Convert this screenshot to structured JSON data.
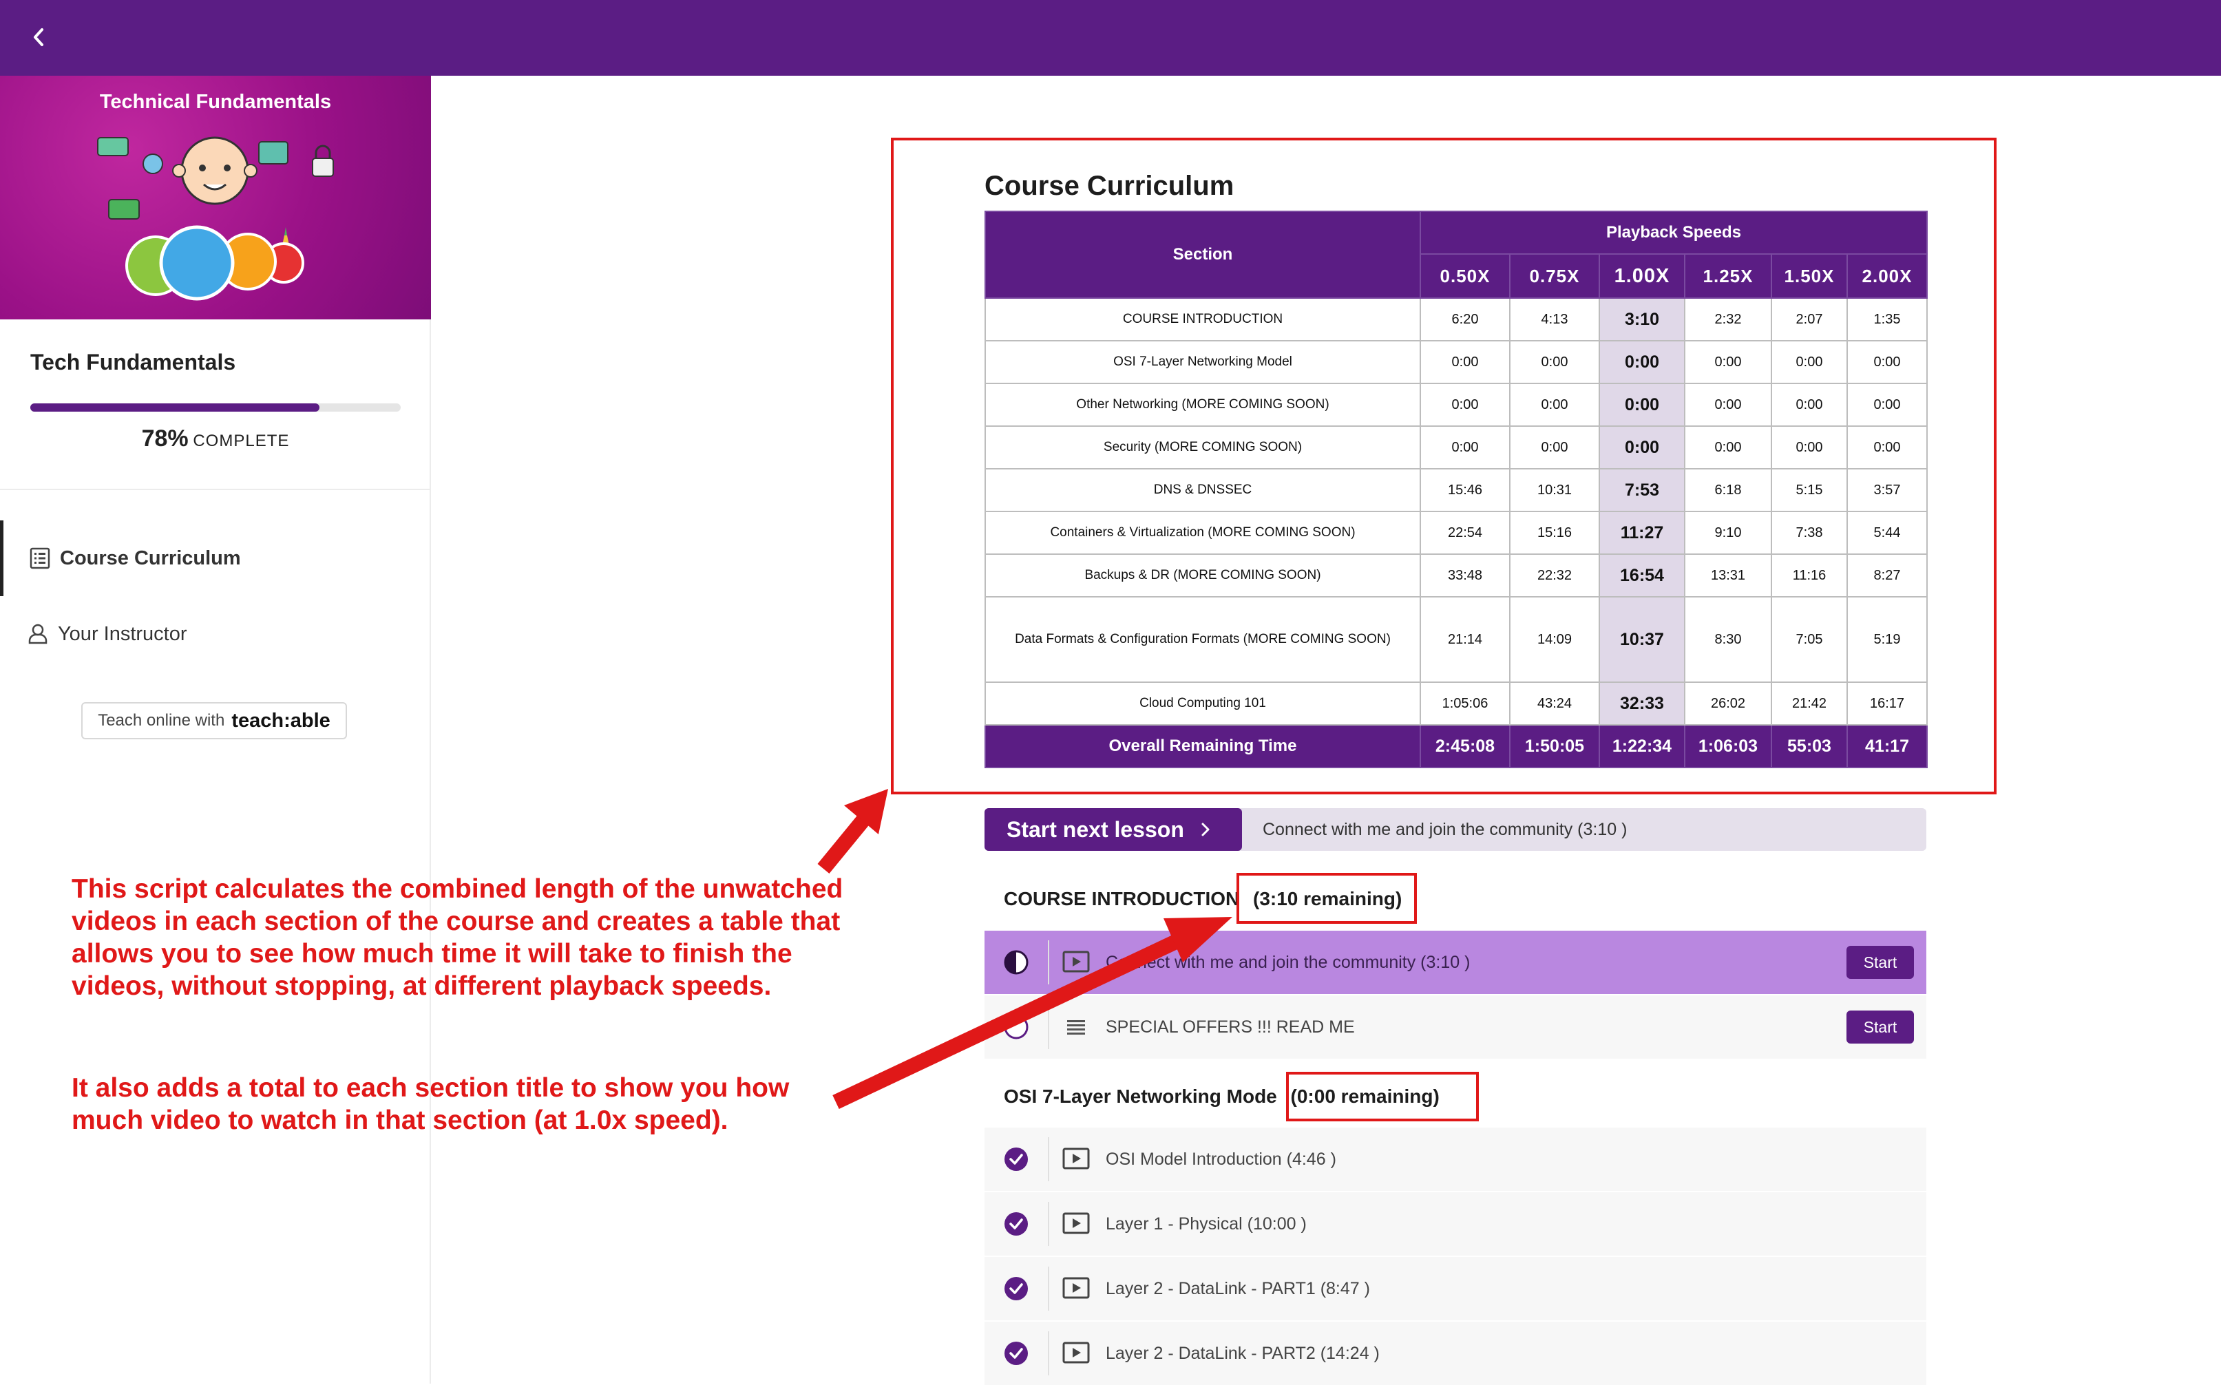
{
  "sidebar": {
    "banner_title": "Technical Fundamentals",
    "course_title": "Tech Fundamentals",
    "progress_percent": 78,
    "progress_pct_label": "78%",
    "progress_complete_label": "COMPLETE",
    "nav": [
      {
        "label": "Course Curriculum",
        "icon": "list-icon",
        "active": true
      },
      {
        "label": "Your Instructor",
        "icon": "user-icon",
        "active": false
      }
    ],
    "teach_prefix": "Teach online with",
    "teach_brand": "teach:able"
  },
  "curriculum_table": {
    "title": "Course Curriculum",
    "section_header": "Section",
    "playback_header": "Playback Speeds",
    "speeds": [
      "0.50X",
      "0.75X",
      "1.00X",
      "1.25X",
      "1.50X",
      "2.00X"
    ],
    "rows": [
      {
        "section": "COURSE INTRODUCTION",
        "times": [
          "6:20",
          "4:13",
          "3:10",
          "2:32",
          "2:07",
          "1:35"
        ]
      },
      {
        "section": "OSI 7-Layer Networking Model",
        "times": [
          "0:00",
          "0:00",
          "0:00",
          "0:00",
          "0:00",
          "0:00"
        ]
      },
      {
        "section": "Other Networking (MORE COMING SOON)",
        "times": [
          "0:00",
          "0:00",
          "0:00",
          "0:00",
          "0:00",
          "0:00"
        ]
      },
      {
        "section": "Security (MORE COMING SOON)",
        "times": [
          "0:00",
          "0:00",
          "0:00",
          "0:00",
          "0:00",
          "0:00"
        ]
      },
      {
        "section": "DNS & DNSSEC",
        "times": [
          "15:46",
          "10:31",
          "7:53",
          "6:18",
          "5:15",
          "3:57"
        ]
      },
      {
        "section": "Containers & Virtualization (MORE COMING SOON)",
        "times": [
          "22:54",
          "15:16",
          "11:27",
          "9:10",
          "7:38",
          "5:44"
        ]
      },
      {
        "section": "Backups & DR (MORE COMING SOON)",
        "times": [
          "33:48",
          "22:32",
          "16:54",
          "13:31",
          "11:16",
          "8:27"
        ]
      },
      {
        "section": "Data Formats & Configuration Formats (MORE COMING SOON)",
        "times": [
          "21:14",
          "14:09",
          "10:37",
          "8:30",
          "7:05",
          "5:19"
        ]
      },
      {
        "section": "Cloud Computing 101",
        "times": [
          "1:05:06",
          "43:24",
          "32:33",
          "26:02",
          "21:42",
          "16:17"
        ]
      }
    ],
    "total": {
      "section": "Overall Remaining Time",
      "times": [
        "2:45:08",
        "1:50:05",
        "1:22:34",
        "1:06:03",
        "55:03",
        "41:17"
      ]
    }
  },
  "start_next": {
    "button_label": "Start next lesson",
    "lesson_text": "Connect with me and join the community (3:10 )"
  },
  "sections": [
    {
      "title": "COURSE INTRODUCTION",
      "remaining": "(3:10 remaining)",
      "lessons": [
        {
          "title": "Connect with me and join the community (3:10 )",
          "icon": "video-icon",
          "status": "in-progress",
          "button": "Start",
          "current": true
        },
        {
          "title": "SPECIAL OFFERS !!! READ ME",
          "icon": "text-lines-icon",
          "status": "not-started",
          "button": "Start",
          "current": false
        }
      ]
    },
    {
      "title": "OSI 7-Layer Networking Mode",
      "remaining": "(0:00 remaining)",
      "lessons": [
        {
          "title": "OSI Model Introduction (4:46 )",
          "icon": "video-icon",
          "status": "completed"
        },
        {
          "title": "Layer 1 - Physical (10:00 )",
          "icon": "video-icon",
          "status": "completed"
        },
        {
          "title": "Layer 2 - DataLink - PART1 (8:47 )",
          "icon": "video-icon",
          "status": "completed"
        },
        {
          "title": "Layer 2 - DataLink - PART2 (14:24 )",
          "icon": "video-icon",
          "status": "completed"
        }
      ]
    }
  ],
  "annotations": {
    "paragraph1": [
      "This script calculates the combined length of the unwatched",
      "videos in each section of the course and creates a table that",
      "allows you to see how much time it will take to finish the",
      "videos, without stopping, at different playback speeds."
    ],
    "paragraph2": [
      "It also adds a total to each section title to show you how",
      "much video to watch in that section (at 1.0x speed)."
    ]
  },
  "colors": {
    "brand_purple": "#5b1d84",
    "highlight_column": "#e0d8e8",
    "current_lesson": "#b987e0",
    "annotation_red": "#e01818"
  }
}
